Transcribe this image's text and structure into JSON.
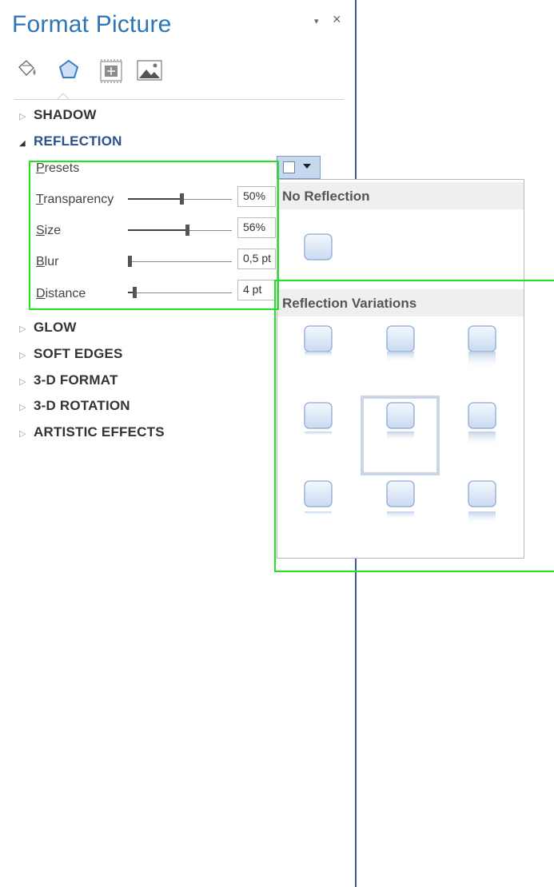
{
  "pane": {
    "title": "Format Picture",
    "pin_glyph": "▾",
    "close_glyph": "×",
    "tabs": [
      {
        "name": "fill-line",
        "icon": "paint-bucket-icon"
      },
      {
        "name": "effects",
        "icon": "pentagon-icon",
        "selected": true
      },
      {
        "name": "size-properties",
        "icon": "size-position-icon"
      },
      {
        "name": "picture",
        "icon": "picture-icon"
      }
    ]
  },
  "sections": {
    "shadow": "SHADOW",
    "reflection": "REFLECTION",
    "glow": "GLOW",
    "soft_edges": "SOFT EDGES",
    "format_3d": "3-D FORMAT",
    "rotation_3d": "3-D ROTATION",
    "artistic": "ARTISTIC EFFECTS"
  },
  "reflection": {
    "presets_first": "P",
    "presets_rest": "resets",
    "transparency_first": "T",
    "transparency_rest": "ransparency",
    "transparency_value": "50%",
    "transparency_level": 0.5,
    "size_first": "S",
    "size_rest": "ize",
    "size_value": "56%",
    "size_level": 0.56,
    "blur_first": "B",
    "blur_rest": "lur",
    "blur_value": "0,5 pt",
    "blur_level": 0.01,
    "distance_first": "D",
    "distance_rest": "istance",
    "distance_value": "4 pt",
    "distance_level": 0.04
  },
  "dropdown": {
    "no_reflection_header": "No Reflection",
    "variations_header": "Reflection Variations"
  },
  "colors": {
    "title": "#2e75b6",
    "accent_highlight": "#22e322",
    "section_open": "#2c4f8f"
  }
}
